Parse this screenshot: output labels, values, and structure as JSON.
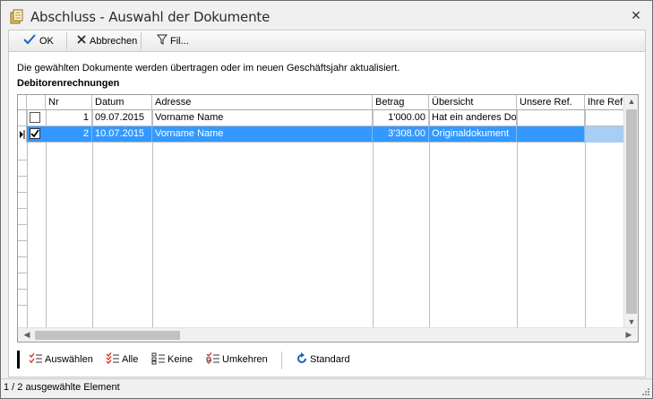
{
  "window": {
    "title": "Abschluss - Auswahl der Dokumente",
    "close_glyph": "✕"
  },
  "toolbar": {
    "ok_label": "OK",
    "cancel_label": "Abbrechen",
    "filter_label": "Fil..."
  },
  "main": {
    "info_text": "Die gewählten Dokumente werden übertragen oder im neuen Geschäftsjahr aktualisiert.",
    "section_title": "Debitorenrechnungen"
  },
  "table": {
    "columns": [
      "Nr",
      "Datum",
      "Adresse",
      "Betrag",
      "Übersicht",
      "Unsere Ref.",
      "Ihre Ref."
    ],
    "rows": [
      {
        "checked": false,
        "selected": false,
        "nr": "1",
        "datum": "09.07.2015",
        "adresse": "Vorname Name",
        "betrag": "1'000.00",
        "uebersicht": "Hat ein anderes Dok",
        "unsere_ref": "",
        "ihre_ref": ""
      },
      {
        "checked": true,
        "selected": true,
        "nr": "2",
        "datum": "10.07.2015",
        "adresse": "Vorname Name",
        "betrag": "3'308.00",
        "uebersicht": "Originaldokument",
        "unsere_ref": "",
        "ihre_ref": ""
      }
    ]
  },
  "actions": {
    "select_label": "Auswählen",
    "all_label": "Alle",
    "none_label": "Keine",
    "invert_label": "Umkehren",
    "standard_label": "Standard"
  },
  "status": {
    "text": "1 / 2 ausgewählte Element"
  },
  "colors": {
    "selection": "#3399ff",
    "accent_blue": "#1f5fbf",
    "checklist_red": "#d83a2a"
  },
  "icons": {
    "window": "document-stack-icon",
    "ok": "checkmark-icon",
    "cancel": "x-icon",
    "filter": "funnel-icon",
    "standard": "refresh-icon"
  }
}
